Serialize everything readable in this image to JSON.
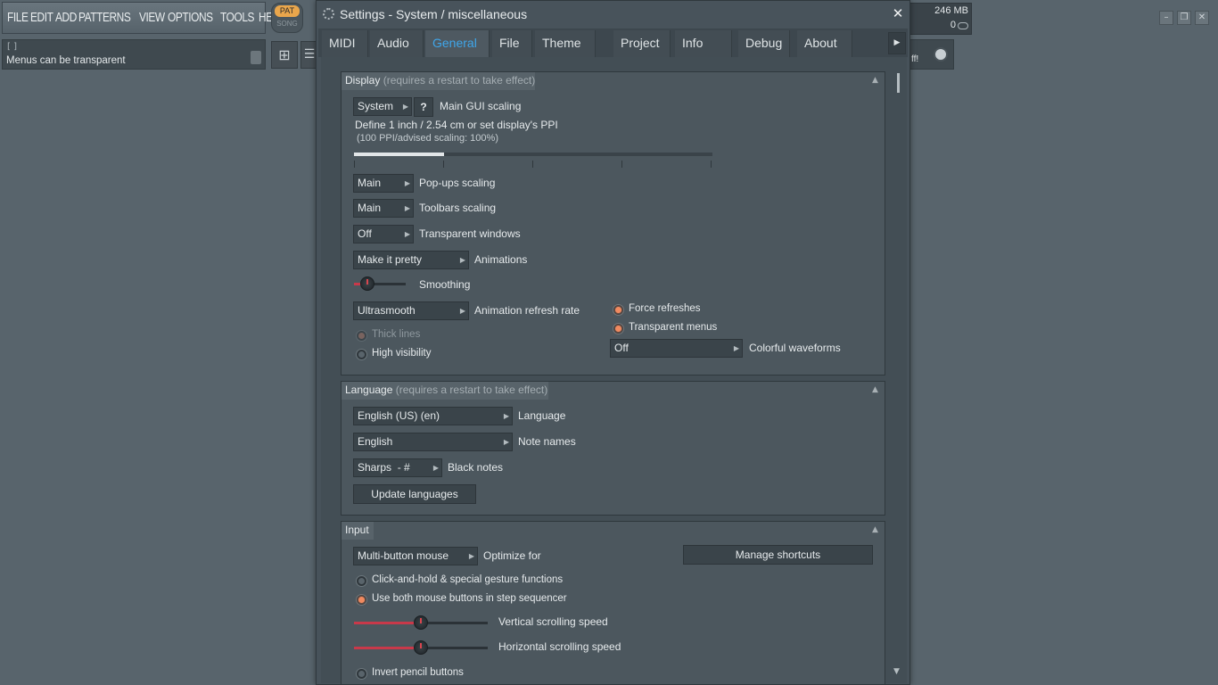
{
  "host": {
    "menu": [
      "FILE",
      "EDIT",
      "ADD",
      "PATTERNS",
      "VIEW",
      "OPTIONS",
      "TOOLS",
      "HELP"
    ],
    "pat_label": "PAT",
    "song_label": "SONG",
    "hint_brackets": "[ ]",
    "hint_text": "Menus can be transparent",
    "memory": "246 MB",
    "cpu": "0",
    "news_text": "ff!"
  },
  "dialog": {
    "title": "Settings - System / miscellaneous",
    "tabs": [
      "MIDI",
      "Audio",
      "General",
      "File",
      "Theme",
      "Project",
      "Info",
      "Debug",
      "About"
    ],
    "active_tab": "General"
  },
  "display": {
    "title": "Display",
    "note": "(requires a restart to take effect)",
    "gui_scaling_value": "System",
    "gui_scaling_help": "?",
    "gui_scaling_label": "Main GUI scaling",
    "ppi_label": "Define 1 inch / 2.54 cm or set display's PPI",
    "ppi_note": "(100 PPI/advised scaling: 100%)",
    "ppi_slider_fraction": 0.25,
    "popups_value": "Main",
    "popups_label": "Pop-ups scaling",
    "toolbars_value": "Main",
    "toolbars_label": "Toolbars scaling",
    "transparent_value": "Off",
    "transparent_label": "Transparent windows",
    "animations_value": "Make it pretty",
    "animations_label": "Animations",
    "smoothing_label": "Smoothing",
    "refresh_value": "Ultrasmooth",
    "refresh_label": "Animation refresh rate",
    "force_refreshes": "Force refreshes",
    "transparent_menus": "Transparent menus",
    "thick_lines": "Thick lines",
    "high_visibility": "High visibility",
    "waveforms_value": "Off",
    "waveforms_label": "Colorful waveforms"
  },
  "language": {
    "title": "Language",
    "note": "(requires a restart to take effect)",
    "language_value": "English (US) (en)",
    "language_label": "Language",
    "note_names_value": "English",
    "note_names_label": "Note names",
    "black_notes_value": "Sharps  - #",
    "black_notes_label": "Black notes",
    "update_button": "Update languages"
  },
  "input": {
    "title": "Input",
    "optimize_value": "Multi-button mouse",
    "optimize_label": "Optimize for",
    "manage_shortcuts": "Manage shortcuts",
    "click_hold": "Click-and-hold & special gesture functions",
    "both_buttons": "Use both mouse buttons in step sequencer",
    "vertical_label": "Vertical scrolling speed",
    "horizontal_label": "Horizontal scrolling speed",
    "invert_pencil": "Invert pencil buttons",
    "vertical_fraction": 0.5,
    "horizontal_fraction": 0.5
  },
  "colors": {
    "accent_tab": "#3fa6ea",
    "radio_on": "#f08a60",
    "slider_red": "#c8394a"
  }
}
